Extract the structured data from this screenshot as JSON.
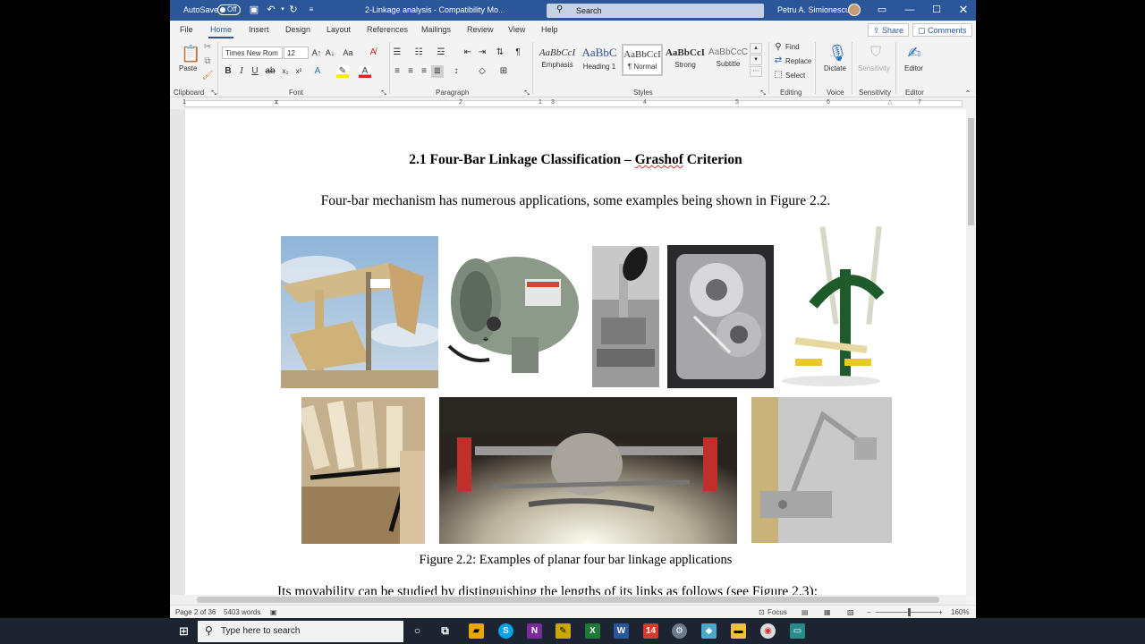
{
  "titlebar": {
    "autosave_label": "AutoSave",
    "autosave_state": "Off",
    "doc_title": "2-Linkage analysis  -  Compatibility Mo...",
    "search_placeholder": "Search",
    "user_name": "Petru A. Simionescu"
  },
  "tabs": [
    "File",
    "Home",
    "Insert",
    "Design",
    "Layout",
    "References",
    "Mailings",
    "Review",
    "View",
    "Help"
  ],
  "share_label": "Share",
  "comments_label": "Comments",
  "ribbon": {
    "clipboard": {
      "paste_label": "Paste",
      "group": "Clipboard"
    },
    "font": {
      "name": "Times New Rom",
      "size": "12",
      "group": "Font"
    },
    "paragraph": {
      "group": "Paragraph"
    },
    "styles": {
      "group": "Styles",
      "items": [
        {
          "sample": "AaBbCcI",
          "name": "Emphasis"
        },
        {
          "sample": "AaBbC",
          "name": "Heading 1"
        },
        {
          "sample": "AaBbCcI",
          "name": "¶ Normal"
        },
        {
          "sample": "AaBbCcI",
          "name": "Strong"
        },
        {
          "sample": "AaBbCcC",
          "name": "Subtitle"
        }
      ]
    },
    "editing": {
      "find": "Find",
      "replace": "Replace",
      "select": "Select",
      "group": "Editing"
    },
    "voice": {
      "dictate": "Dictate",
      "group": "Voice"
    },
    "sensitivity": {
      "label": "Sensitivity",
      "group": "Sensitivity"
    },
    "editor": {
      "label": "Editor",
      "group": "Editor"
    }
  },
  "ruler_numbers": [
    "1",
    "1",
    "2",
    "3",
    "4",
    "5",
    "6",
    "7"
  ],
  "document": {
    "heading_part1": "2.1 Four-Bar Linkage Classification – ",
    "heading_part2": "Grashof",
    "heading_part3": " Criterion",
    "para1": "Four-bar mechanism has numerous applications, some examples being shown in Figure 2.2.",
    "caption": "Figure 2.2: Examples of planar four bar linkage applications",
    "para2": "Its movability can be studied by distinguishing the lengths of its links as follows (see Figure 2.3):"
  },
  "statusbar": {
    "page": "Page 2 of 36",
    "words": "5403 words",
    "focus": "Focus",
    "zoom": "160%"
  },
  "taskbar": {
    "search_placeholder": "Type here to search"
  }
}
